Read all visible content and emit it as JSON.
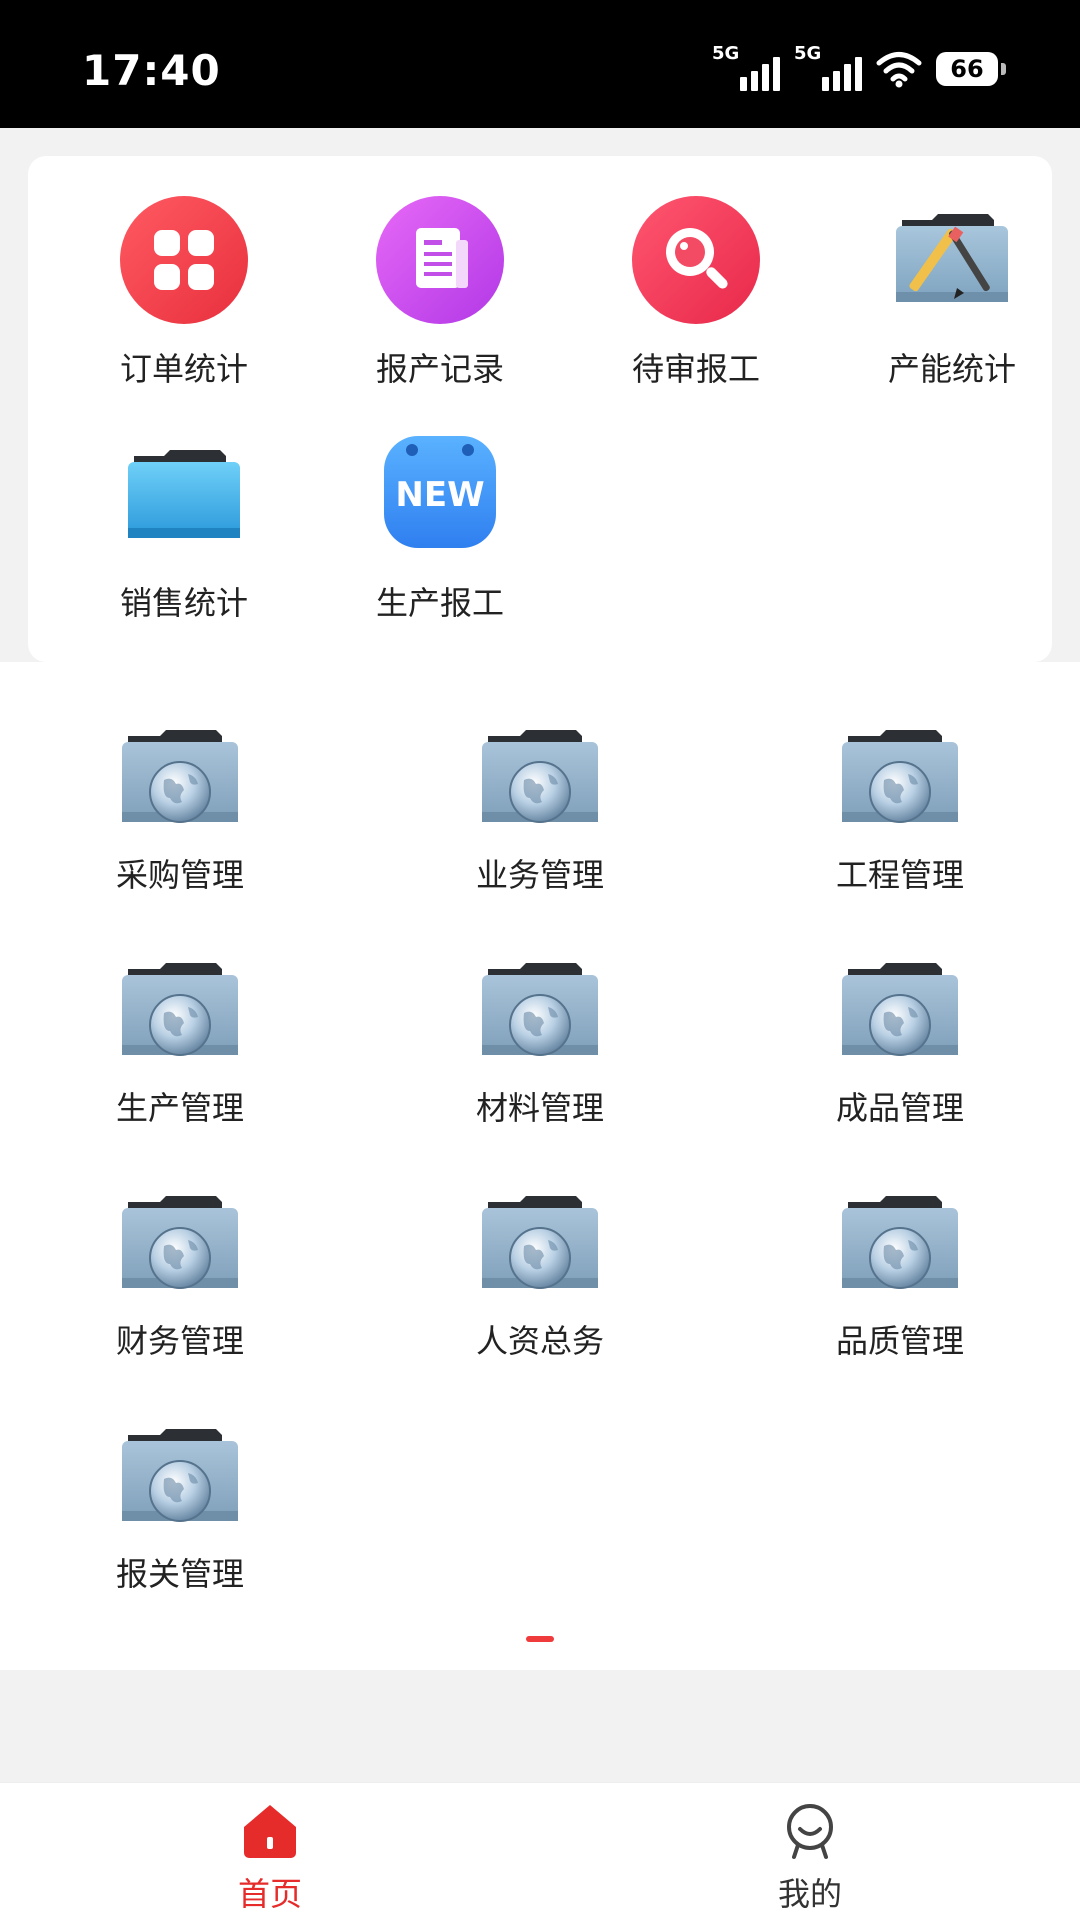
{
  "status_bar": {
    "time": "17:40",
    "signal_1": "5G",
    "signal_2": "5G",
    "battery": "66",
    "icons": [
      "signal-icon",
      "signal-icon",
      "wifi-icon",
      "battery-icon"
    ]
  },
  "top_card": {
    "items": [
      {
        "label": "订单统计",
        "icon": "grid-apps-icon",
        "color": "#f2434f"
      },
      {
        "label": "报产记录",
        "icon": "document-icon",
        "color": "#d24ef0"
      },
      {
        "label": "待审报工",
        "icon": "search-icon",
        "color": "#ef3f5d"
      },
      {
        "label": "产能统计",
        "icon": "tools-folder-icon",
        "color": "#8fb3cf"
      },
      {
        "label": "销售统计",
        "icon": "blue-folder-icon",
        "color": "#35a8e8"
      },
      {
        "label": "生产报工",
        "icon": "new-badge-icon",
        "color": "#3b8ef0",
        "badge_text": "NEW"
      }
    ]
  },
  "grid": {
    "items": [
      {
        "label": "采购管理",
        "icon": "globe-folder-icon"
      },
      {
        "label": "业务管理",
        "icon": "globe-folder-icon"
      },
      {
        "label": "工程管理",
        "icon": "globe-folder-icon"
      },
      {
        "label": "生产管理",
        "icon": "globe-folder-icon"
      },
      {
        "label": "材料管理",
        "icon": "globe-folder-icon"
      },
      {
        "label": "成品管理",
        "icon": "globe-folder-icon"
      },
      {
        "label": "财务管理",
        "icon": "globe-folder-icon"
      },
      {
        "label": "人资总务",
        "icon": "globe-folder-icon"
      },
      {
        "label": "品质管理",
        "icon": "globe-folder-icon"
      },
      {
        "label": "报关管理",
        "icon": "globe-folder-icon"
      }
    ]
  },
  "tab_bar": {
    "tabs": [
      {
        "label": "首页",
        "icon": "home-icon",
        "active": true,
        "color": "#e62b2b"
      },
      {
        "label": "我的",
        "icon": "profile-icon",
        "active": false,
        "color": "#333333"
      }
    ]
  },
  "colors": {
    "accent": "#e62b2b",
    "page_bg": "#f2f2f2"
  }
}
